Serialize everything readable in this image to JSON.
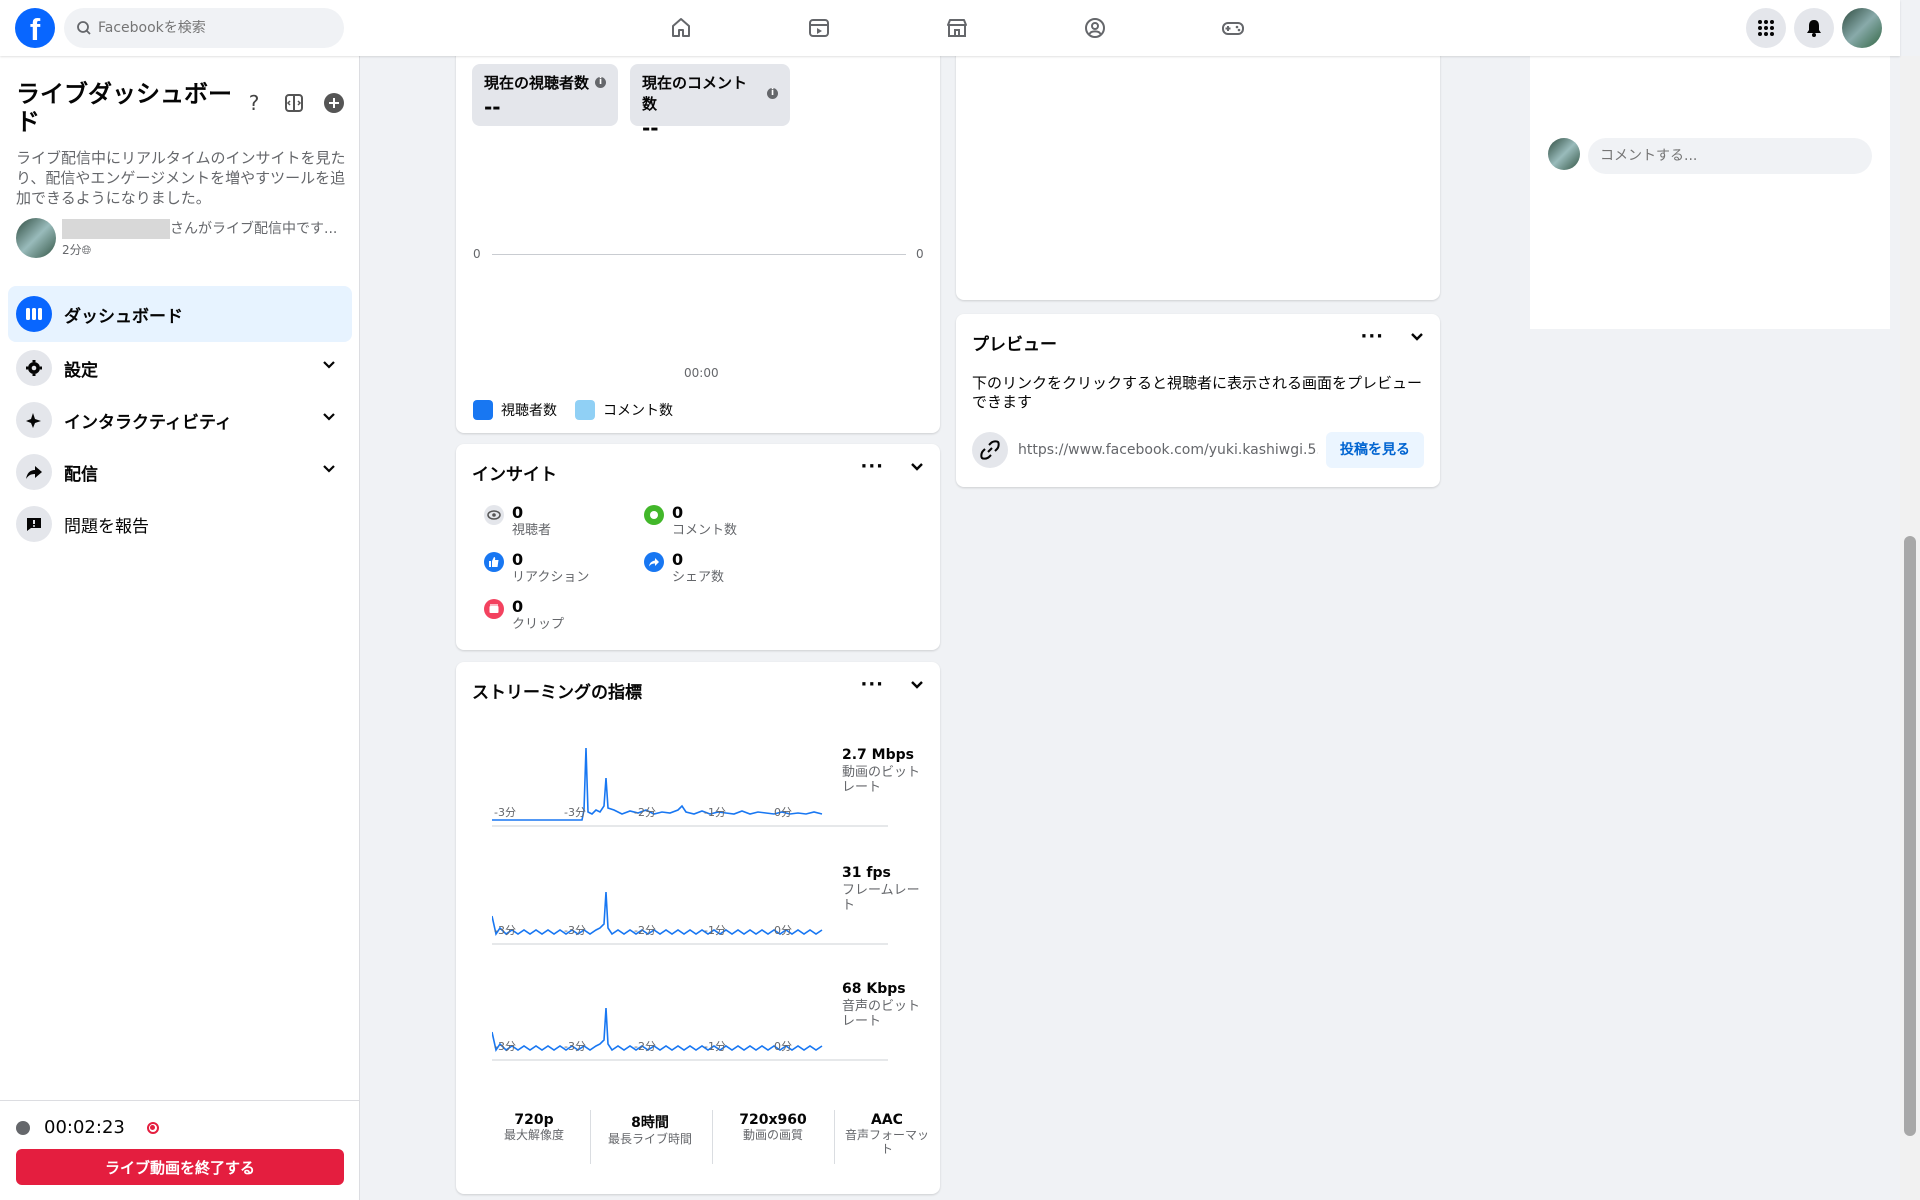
{
  "topbar": {
    "logo": "f",
    "search_placeholder": "Facebookを検索",
    "nav_icons": [
      "home-icon",
      "video-icon",
      "marketplace-icon",
      "groups-icon",
      "gaming-icon"
    ]
  },
  "sidebar": {
    "title": "ライブダッシュボード",
    "help": "?",
    "description": "ライブ配信中にリアルタイムのインサイトを見たり、配信やエンゲージメントを増やすツールを追加できるようになりました。",
    "live_status_text": "さんがライブ配信中です...",
    "live_status_time": "2分",
    "menu": [
      {
        "label": "ダッシュボード"
      },
      {
        "label": "設定"
      },
      {
        "label": "インタラクティビティ"
      },
      {
        "label": "配信"
      },
      {
        "label": "問題を報告"
      }
    ],
    "timer": "00:02:23",
    "end_button": "ライブ動画を終了する"
  },
  "viewers_card": {
    "current_viewers_label": "現在の視聴者数",
    "current_viewers_value": "--",
    "current_comments_label": "現在のコメント数",
    "current_comments_value": "--",
    "y_left": "0",
    "y_right": "0",
    "x_label": "00:00",
    "legend_viewers": "視聴者数",
    "legend_comments": "コメント数",
    "legend_viewers_color": "#1877f2",
    "legend_comments_color": "#90d0f5"
  },
  "insights": {
    "title": "インサイト",
    "items": [
      {
        "value": "0",
        "label": "視聴者"
      },
      {
        "value": "0",
        "label": "コメント数"
      },
      {
        "value": "0",
        "label": "リアクション"
      },
      {
        "value": "0",
        "label": "シェア数"
      },
      {
        "value": "0",
        "label": "クリップ"
      }
    ]
  },
  "streaming": {
    "title": "ストリーミングの指標",
    "metrics": [
      {
        "value": "2.7 Mbps",
        "label": "動画のビットレート"
      },
      {
        "value": "31 fps",
        "label": "フレームレート"
      },
      {
        "value": "68 Kbps",
        "label": "音声のビットレート"
      }
    ],
    "x_ticks": [
      "-3分",
      "-3分",
      "-2分",
      "-1分",
      "0分"
    ],
    "specs": [
      {
        "value": "720p",
        "label": "最大解像度"
      },
      {
        "value": "8時間",
        "label": "最長ライブ時間"
      },
      {
        "value": "720x960",
        "label": "動画の画質"
      },
      {
        "value": "AAC",
        "label": "音声フォーマット"
      }
    ]
  },
  "preview": {
    "title": "プレビュー",
    "description": "下のリンクをクリックすると視聴者に表示される画面をプレビューできます",
    "url": "https://www.facebook.com/yuki.kashiwgi.5...",
    "view_button": "投稿を見る"
  },
  "comments": {
    "placeholder": "コメントする..."
  },
  "colors": {
    "accent": "#0866ff",
    "danger": "#e41e3f",
    "chart_line": "#1877f2"
  }
}
